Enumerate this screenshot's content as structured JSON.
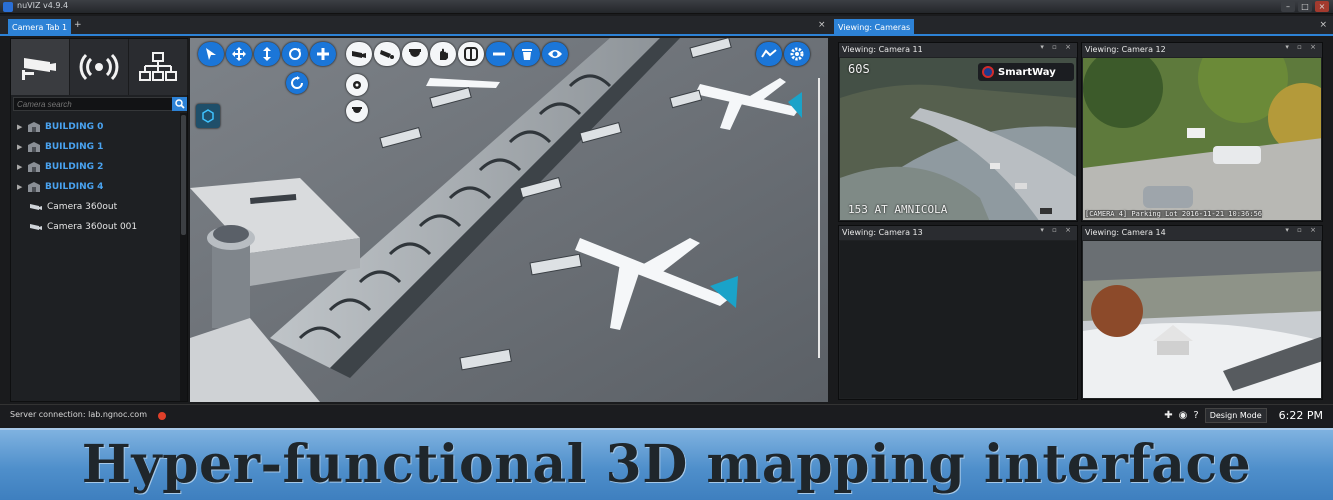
{
  "window": {
    "title": "nuVIZ v4.9.4"
  },
  "left_tabs": {
    "active": "Camera Tab 1",
    "add": "+",
    "close": "×"
  },
  "sidebar": {
    "search_placeholder": "Camera search",
    "tree": [
      {
        "label": "BUILDING 0",
        "type": "building"
      },
      {
        "label": "BUILDING 1",
        "type": "building"
      },
      {
        "label": "BUILDING 2",
        "type": "building"
      },
      {
        "label": "BUILDING 4",
        "type": "building"
      },
      {
        "label": "Camera 360out",
        "type": "camera"
      },
      {
        "label": "Camera 360out 001",
        "type": "camera"
      }
    ]
  },
  "right_tabs": {
    "active": "Viewing: Cameras",
    "close": "×"
  },
  "cameras": [
    {
      "title": "Viewing: Camera 11",
      "overlay_top": "60S",
      "overlay_bottom": "153 AT AMNICOLA",
      "logo": "SmartWay"
    },
    {
      "title": "Viewing: Camera 12",
      "overlay_bottom": "[CAMERA 4] Parking Lot 2016-11-21 10:36:56"
    },
    {
      "title": "Viewing: Camera 13"
    },
    {
      "title": "Viewing: Camera 14"
    }
  ],
  "status": {
    "server": "Server connection: lab.ngnoc.com",
    "design_mode": "Design Mode",
    "time": "6:22 PM",
    "connection_color": "#e0402a"
  },
  "banner": {
    "text": "Hyper-functional 3D mapping interface"
  },
  "colors": {
    "accent": "#2d82d6",
    "tree_building": "#4aa3f0"
  }
}
